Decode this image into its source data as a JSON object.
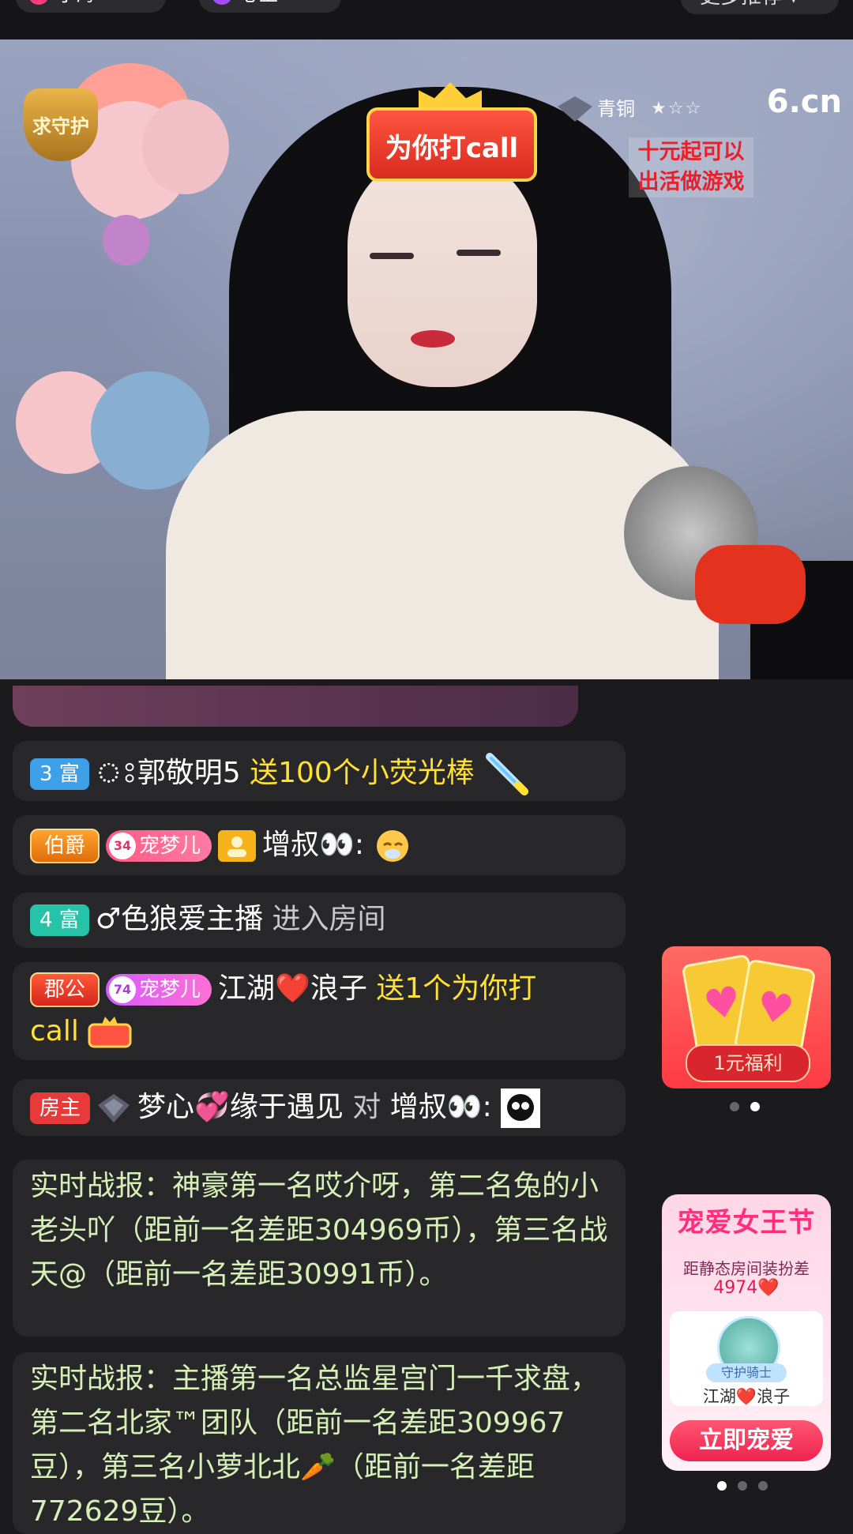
{
  "topbar": {
    "tab1_label": "小海",
    "tab2_label": "心上",
    "more_label": "更多推荐 ▾"
  },
  "video": {
    "guard_badge": "求守护",
    "call_sign": "为你打call",
    "rank_label": "青铜",
    "rank_stars": "★☆☆",
    "logo": "6.cn",
    "promo_text": "十元起可以出活做游戏"
  },
  "chat": {
    "m1": {
      "level": "3 富",
      "user": "ঃ郭敬明5",
      "action": "送100个小荧光棒"
    },
    "m2": {
      "noble": "伯爵",
      "fan_level": "34",
      "fan_club": "宠梦儿",
      "user": "增叔👀:"
    },
    "m3": {
      "level": "4 富",
      "user": "♂色狼爱主播",
      "action": "进入房间"
    },
    "m4": {
      "noble": "郡公",
      "fan_level": "74",
      "fan_club": "宠梦儿",
      "user": "江湖❤️浪子",
      "action_a": "送1个为你打",
      "action_b": "call"
    },
    "m5": {
      "role": "房主",
      "user": "梦心💞缘于遇见",
      "to": "对",
      "target": "增叔👀:"
    },
    "s1": "实时战报：神豪第一名哎介呀，第二名兔的小老头吖（距前一名差距304969币），第三名战天@（距前一名差距30991币）。",
    "s2": "实时战报：主播第一名总监星宫门一千求盘，第二名北家™团队（距前一名差距309967豆），第三名小萝北北🥕（距前一名差距772629豆）。"
  },
  "gift": {
    "button": "1元福利"
  },
  "queen": {
    "title": "宠爱女王节",
    "sub": "距静态房间装扮差",
    "num": "4974❤️",
    "knight": "守护骑士",
    "uname": "江湖❤️浪子",
    "cta": "立即宠爱"
  },
  "colors": {
    "background": "#1b1b1d",
    "bubble": "#28282b",
    "accent_yellow": "#ffe033",
    "system_green": "#d6efb7"
  }
}
